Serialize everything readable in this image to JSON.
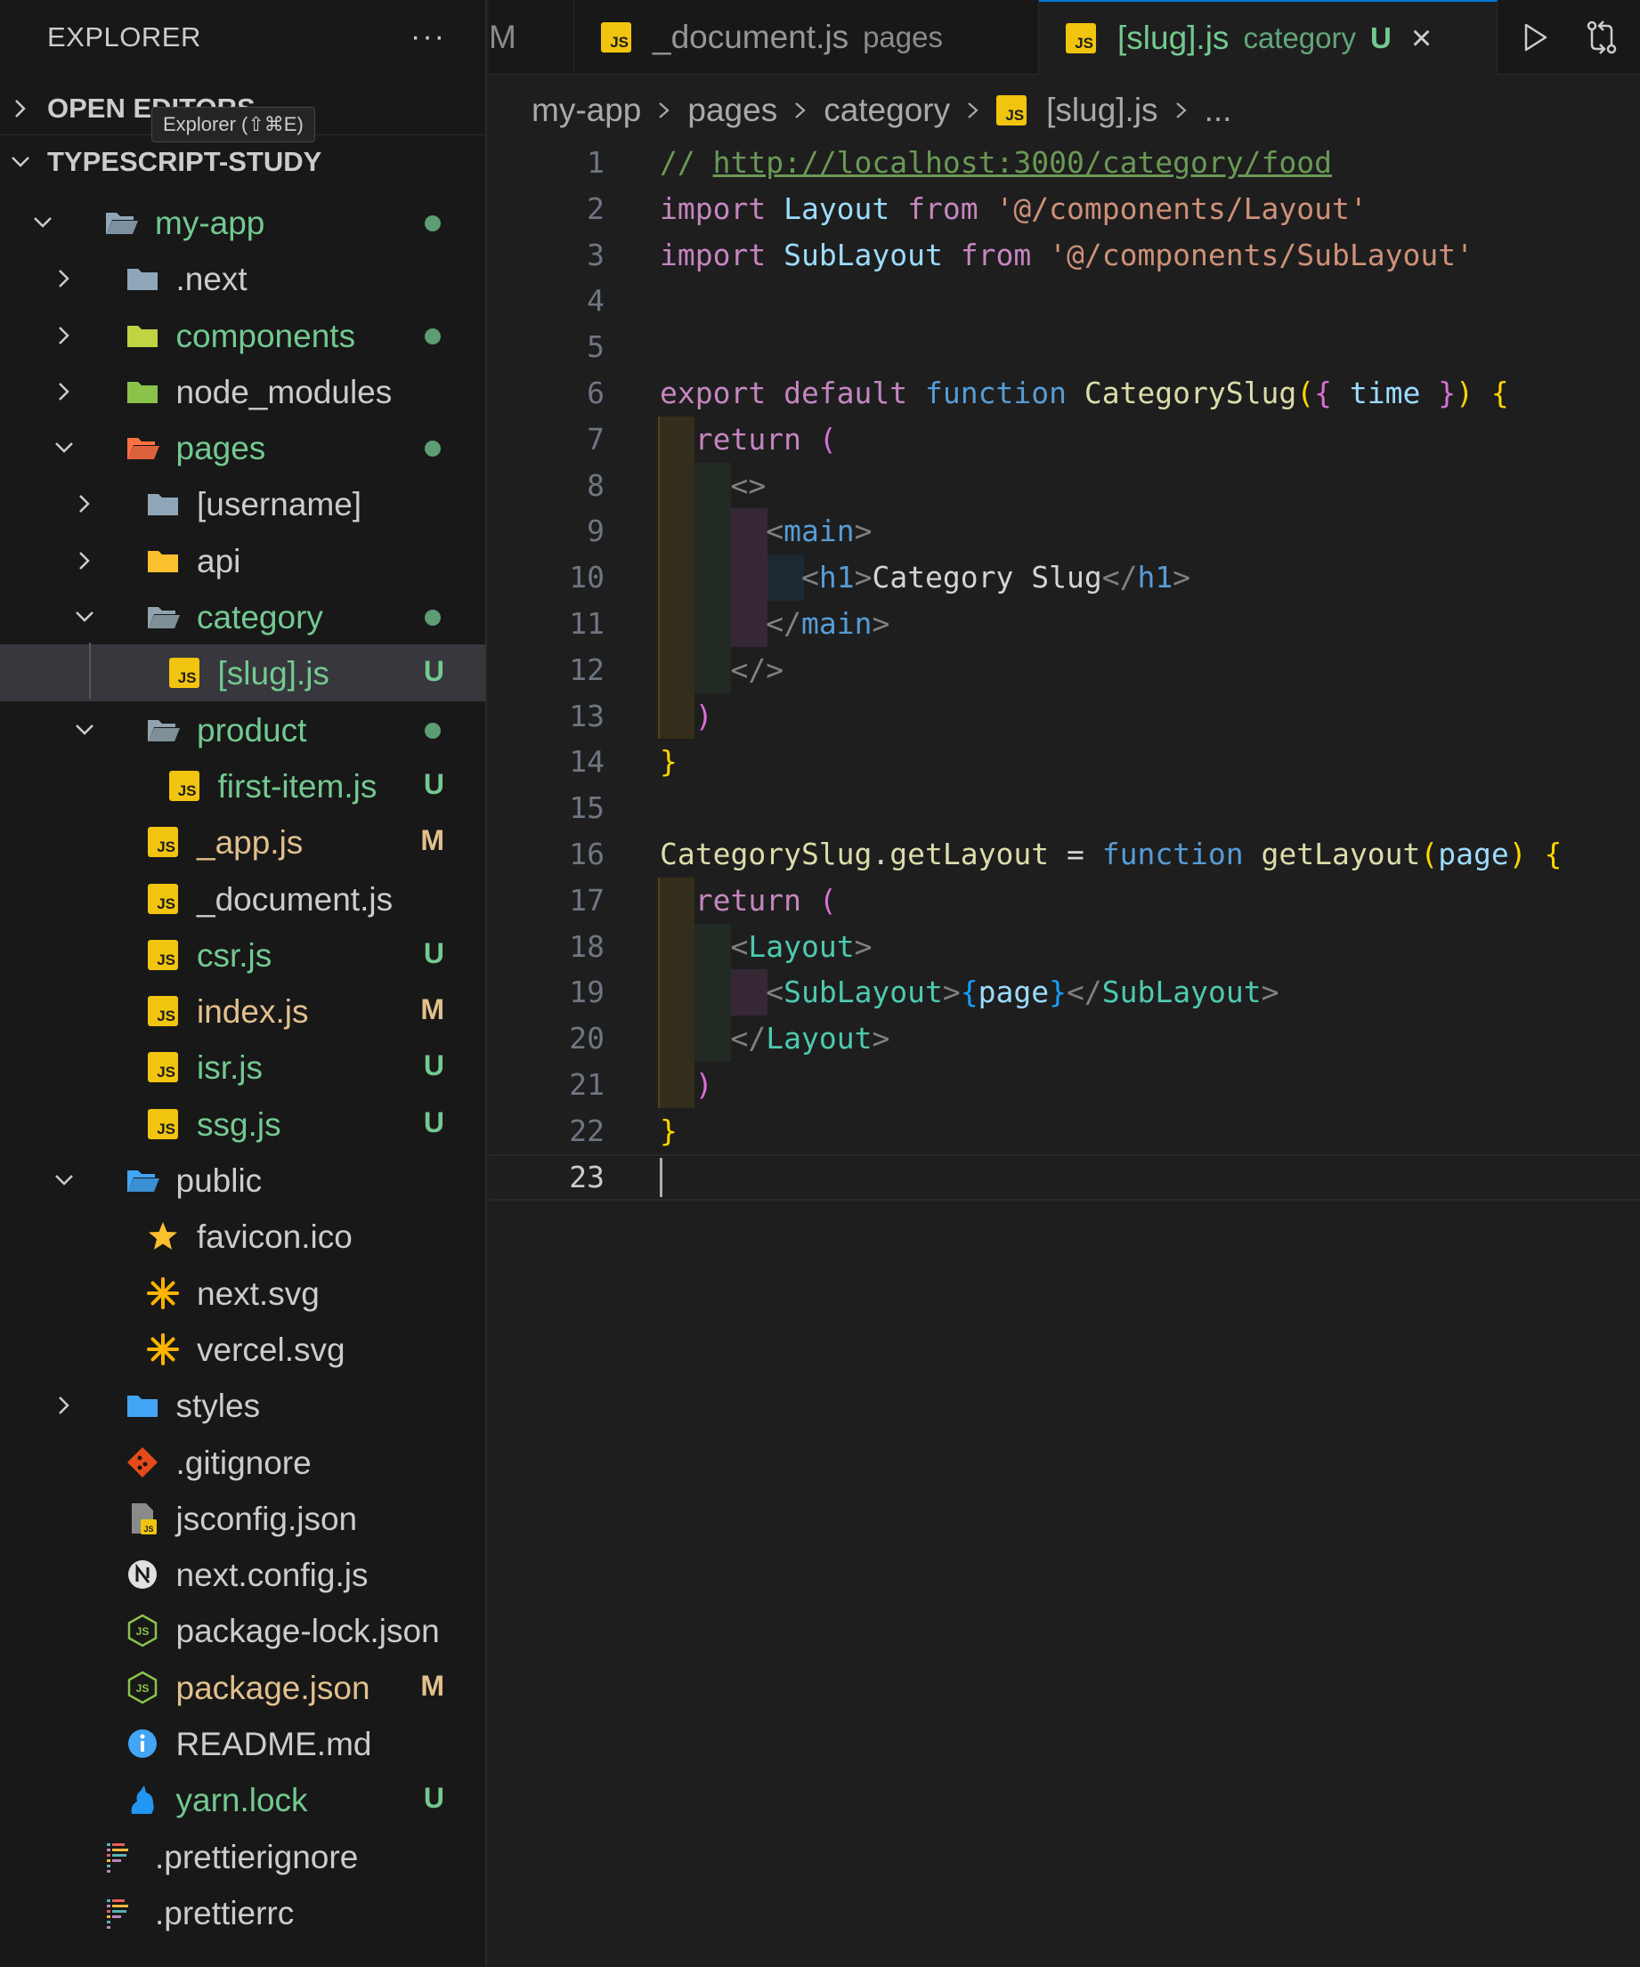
{
  "sidebar": {
    "title": "EXPLORER",
    "more_label": "···",
    "open_editors_label": "OPEN EDITORS",
    "tooltip": "Explorer (⇧⌘E)",
    "workspace_label": "TYPESCRIPT-STUDY",
    "tree": [
      {
        "name": "my-app",
        "kind": "folder-open",
        "status": "dot"
      },
      {
        "name": ".next",
        "kind": "folder"
      },
      {
        "name": "components",
        "kind": "folder",
        "status": "dot"
      },
      {
        "name": "node_modules",
        "kind": "folder"
      },
      {
        "name": "pages",
        "kind": "folder-open",
        "status": "dot"
      },
      {
        "name": "[username]",
        "kind": "folder"
      },
      {
        "name": "api",
        "kind": "folder"
      },
      {
        "name": "category",
        "kind": "folder-open",
        "status": "dot"
      },
      {
        "name": "[slug].js",
        "kind": "js",
        "status": "U"
      },
      {
        "name": "product",
        "kind": "folder-open",
        "status": "dot"
      },
      {
        "name": "first-item.js",
        "kind": "js",
        "status": "U"
      },
      {
        "name": "_app.js",
        "kind": "js",
        "status": "M"
      },
      {
        "name": "_document.js",
        "kind": "js"
      },
      {
        "name": "csr.js",
        "kind": "js",
        "status": "U"
      },
      {
        "name": "index.js",
        "kind": "js",
        "status": "M"
      },
      {
        "name": "isr.js",
        "kind": "js",
        "status": "U"
      },
      {
        "name": "ssg.js",
        "kind": "js",
        "status": "U"
      },
      {
        "name": "public",
        "kind": "folder-open"
      },
      {
        "name": "favicon.ico",
        "kind": "star"
      },
      {
        "name": "next.svg",
        "kind": "asterisk"
      },
      {
        "name": "vercel.svg",
        "kind": "asterisk"
      },
      {
        "name": "styles",
        "kind": "folder"
      },
      {
        "name": ".gitignore",
        "kind": "git"
      },
      {
        "name": "jsconfig.json",
        "kind": "file"
      },
      {
        "name": "next.config.js",
        "kind": "next"
      },
      {
        "name": "package-lock.json",
        "kind": "node"
      },
      {
        "name": "package.json",
        "kind": "node",
        "status": "M"
      },
      {
        "name": "README.md",
        "kind": "info"
      },
      {
        "name": "yarn.lock",
        "kind": "yarn",
        "status": "U"
      },
      {
        "name": ".prettierignore",
        "kind": "prettier"
      },
      {
        "name": ".prettierrc",
        "kind": "prettier"
      }
    ]
  },
  "tabs": {
    "partial_label": "M",
    "document": {
      "name": "_document.js",
      "desc": "pages",
      "icon_label": "JS"
    },
    "slug": {
      "name": "[slug].js",
      "desc": "category",
      "badge": "U",
      "icon_label": "JS"
    },
    "close_icon": "×"
  },
  "breadcrumb": {
    "items": [
      "my-app",
      "pages",
      "category",
      "[slug].js",
      "..."
    ],
    "icon_label": "JS"
  },
  "editor": {
    "active_line": 23,
    "lines": [
      [
        [
          "k-comment",
          "// "
        ],
        [
          "k-url",
          "http://localhost:3000/category/food"
        ]
      ],
      [
        [
          "k-import",
          "import "
        ],
        [
          "k-ident",
          "Layout"
        ],
        [
          "k-import",
          " from "
        ],
        [
          "k-str",
          "'@/components/Layout'"
        ]
      ],
      [
        [
          "k-import",
          "import "
        ],
        [
          "k-ident",
          "SubLayout"
        ],
        [
          "k-import",
          " from "
        ],
        [
          "k-str",
          "'@/components/SubLayout'"
        ]
      ],
      [],
      [],
      [
        [
          "k-import",
          "export default "
        ],
        [
          "k-kw",
          "function "
        ],
        [
          "k-fn",
          "CategorySlug"
        ],
        [
          "k-br1",
          "("
        ],
        [
          "k-br2",
          "{ "
        ],
        [
          "k-ident",
          "time "
        ],
        [
          "k-br2",
          "}"
        ],
        [
          "k-br1",
          ") {"
        ]
      ],
      [
        [
          "k-text",
          "  "
        ],
        [
          "k-import",
          "return "
        ],
        [
          "k-br2",
          "("
        ]
      ],
      [
        [
          "k-text",
          "    "
        ],
        [
          "k-tagp",
          "<>"
        ]
      ],
      [
        [
          "k-text",
          "      "
        ],
        [
          "k-tagp",
          "<"
        ],
        [
          "k-tag",
          "main"
        ],
        [
          "k-tagp",
          ">"
        ]
      ],
      [
        [
          "k-text",
          "        "
        ],
        [
          "k-tagp",
          "<"
        ],
        [
          "k-tag",
          "h1"
        ],
        [
          "k-tagp",
          ">"
        ],
        [
          "k-text",
          "Category Slug"
        ],
        [
          "k-tagp",
          "</"
        ],
        [
          "k-tag",
          "h1"
        ],
        [
          "k-tagp",
          ">"
        ]
      ],
      [
        [
          "k-text",
          "      "
        ],
        [
          "k-tagp",
          "</"
        ],
        [
          "k-tag",
          "main"
        ],
        [
          "k-tagp",
          ">"
        ]
      ],
      [
        [
          "k-text",
          "    "
        ],
        [
          "k-tagp",
          "</>"
        ]
      ],
      [
        [
          "k-text",
          "  "
        ],
        [
          "k-br2",
          ")"
        ]
      ],
      [
        [
          "k-br1",
          "}"
        ]
      ],
      [],
      [
        [
          "k-fn",
          "CategorySlug"
        ],
        [
          "k-text",
          "."
        ],
        [
          "k-fn",
          "getLayout"
        ],
        [
          "k-text",
          " = "
        ],
        [
          "k-kw",
          "function "
        ],
        [
          "k-fn",
          "getLayout"
        ],
        [
          "k-br1",
          "("
        ],
        [
          "k-ident",
          "page"
        ],
        [
          "k-br1",
          ") {"
        ]
      ],
      [
        [
          "k-text",
          "  "
        ],
        [
          "k-import",
          "return "
        ],
        [
          "k-br2",
          "("
        ]
      ],
      [
        [
          "k-text",
          "    "
        ],
        [
          "k-tagp",
          "<"
        ],
        [
          "k-comp",
          "Layout"
        ],
        [
          "k-tagp",
          ">"
        ]
      ],
      [
        [
          "k-text",
          "      "
        ],
        [
          "k-tagp",
          "<"
        ],
        [
          "k-comp",
          "SubLayout"
        ],
        [
          "k-tagp",
          ">"
        ],
        [
          "k-br3",
          "{"
        ],
        [
          "k-ident",
          "page"
        ],
        [
          "k-br3",
          "}"
        ],
        [
          "k-tagp",
          "</"
        ],
        [
          "k-comp",
          "SubLayout"
        ],
        [
          "k-tagp",
          ">"
        ]
      ],
      [
        [
          "k-text",
          "    "
        ],
        [
          "k-tagp",
          "</"
        ],
        [
          "k-comp",
          "Layout"
        ],
        [
          "k-tagp",
          ">"
        ]
      ],
      [
        [
          "k-text",
          "  "
        ],
        [
          "k-br2",
          ")"
        ]
      ],
      [
        [
          "k-br1",
          "}"
        ]
      ],
      []
    ]
  }
}
